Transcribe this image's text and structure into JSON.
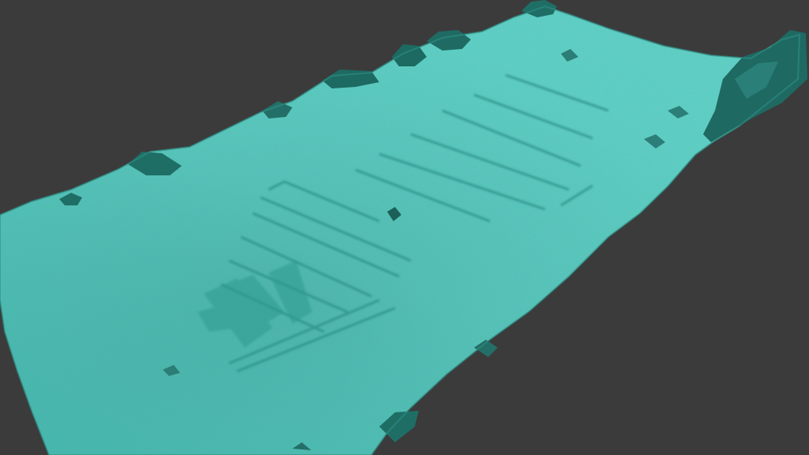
{
  "scene": {
    "background_color": "#3b3b3b",
    "mesh_color": "#4ec9c0",
    "mesh_shadow_color": "#2a8f86",
    "rock_color": "#1f6e66",
    "subject": "photogrammetry-seabed-mesh"
  }
}
